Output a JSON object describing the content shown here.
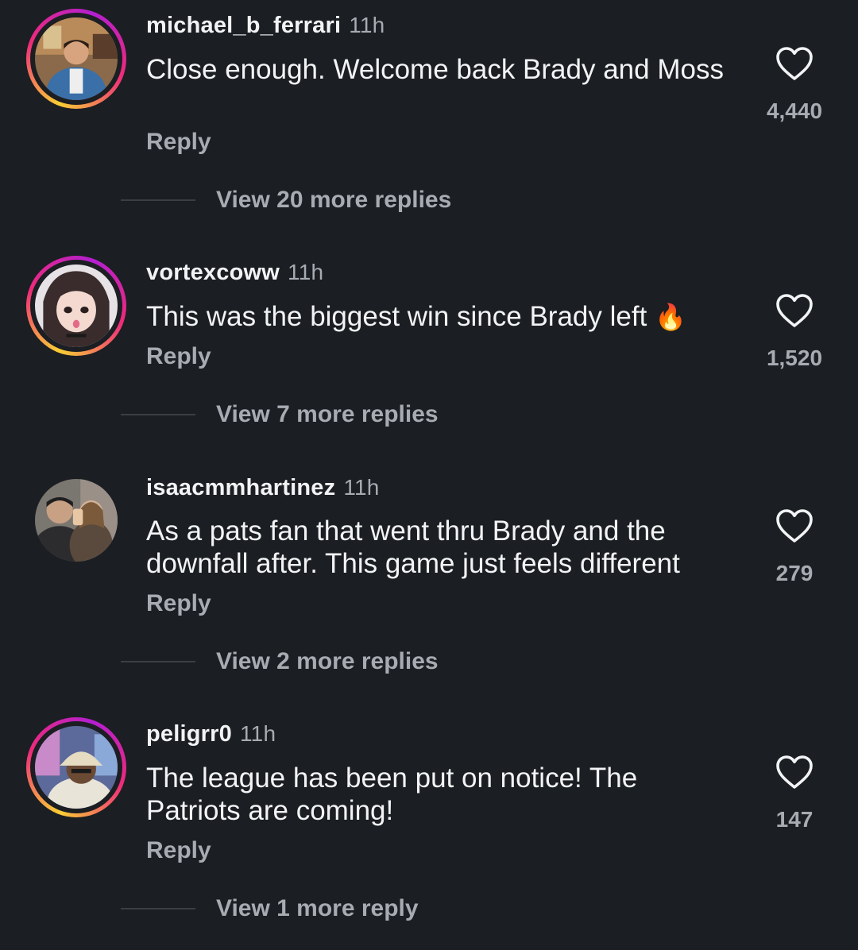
{
  "comments": [
    {
      "username": "michael_b_ferrari",
      "time": "11h",
      "text": "Close enough. Welcome back Brady and Moss",
      "emoji": "",
      "reply_label": "Reply",
      "likes": "4,440",
      "view_replies": "View 20 more replies",
      "has_story_ring": true
    },
    {
      "username": "vortexcoww",
      "time": "11h",
      "text": "This was the biggest win since Brady left",
      "emoji": "🔥",
      "reply_label": "Reply",
      "likes": "1,520",
      "view_replies": "View 7 more replies",
      "has_story_ring": true
    },
    {
      "username": "isaacmmhartinez",
      "time": "11h",
      "text": "As a pats fan that went thru Brady and the downfall after.  This game just feels different",
      "emoji": "",
      "reply_label": "Reply",
      "likes": "279",
      "view_replies": "View 2 more replies",
      "has_story_ring": false
    },
    {
      "username": "peligrr0",
      "time": "11h",
      "text": "The league has been put on notice! The Patriots are coming!",
      "emoji": "",
      "reply_label": "Reply",
      "likes": "147",
      "view_replies": "View 1 more reply",
      "has_story_ring": true
    }
  ],
  "colors": {
    "background": "#1b1e22",
    "primary_text": "#f2f3f5",
    "secondary_text": "#a7abb2",
    "ring_start": "#f9ce34",
    "ring_mid": "#ee2a7b",
    "ring_end": "#b31fd0"
  },
  "icons": {
    "like": "heart-outline-icon"
  }
}
